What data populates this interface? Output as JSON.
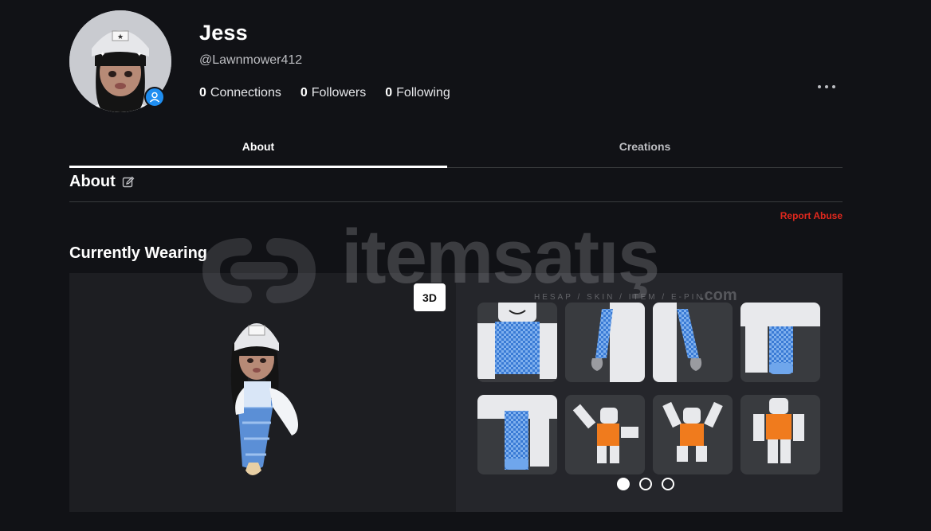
{
  "profile": {
    "display_name": "Jess",
    "username": "@Lawnmower412",
    "stats": [
      {
        "count": "0",
        "label": "Connections"
      },
      {
        "count": "0",
        "label": "Followers"
      },
      {
        "count": "0",
        "label": "Following"
      }
    ]
  },
  "tabs": [
    {
      "label": "About",
      "active": true
    },
    {
      "label": "Creations",
      "active": false
    }
  ],
  "about": {
    "title": "About",
    "report_label": "Report Abuse"
  },
  "wearing": {
    "title": "Currently Wearing",
    "view_toggle": "3D",
    "items": [
      {
        "kind": "checkered-shirt-torso"
      },
      {
        "kind": "checkered-left-arm"
      },
      {
        "kind": "checkered-right-arm"
      },
      {
        "kind": "checkered-pants-left"
      },
      {
        "kind": "checkered-pants-right"
      },
      {
        "kind": "emote-dance-1"
      },
      {
        "kind": "emote-dance-2"
      },
      {
        "kind": "emote-pose-3"
      }
    ],
    "page_count": 3,
    "current_page": 1
  },
  "watermark": {
    "brand": "itemsatış",
    "tagline": "HESAP / SKIN / ITEM / E-PIN",
    "suffix": ".com"
  },
  "colors": {
    "background": "#111216",
    "accent_blue": "#1f8ef1",
    "report_red": "#e0281d",
    "checker_blue": "#3a7bd5",
    "orange": "#f07b1d"
  }
}
